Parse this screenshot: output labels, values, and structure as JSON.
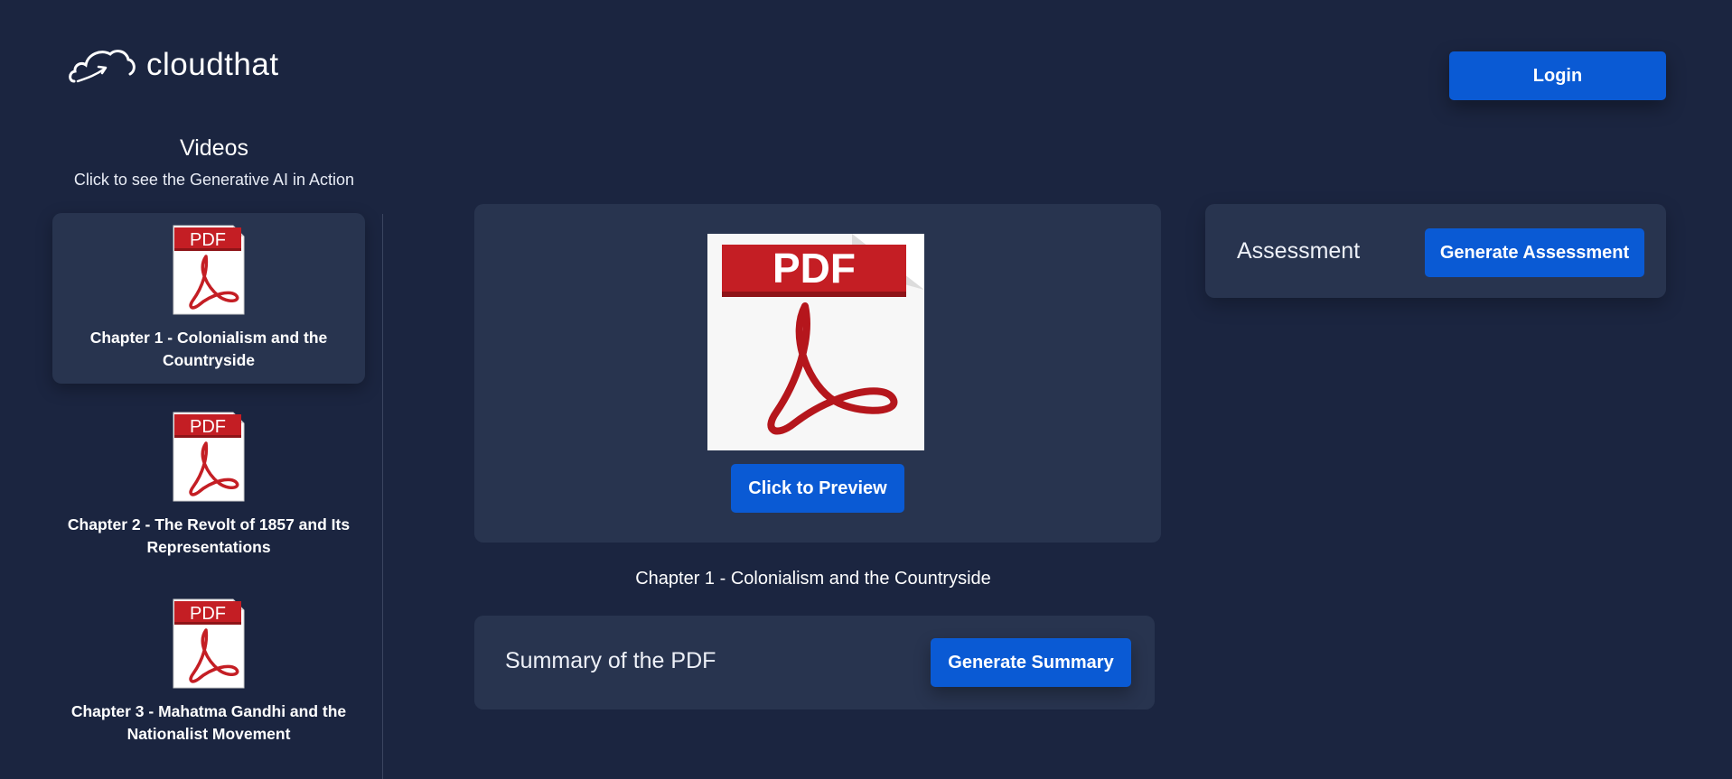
{
  "header": {
    "logo_text": "cloudthat",
    "login_label": "Login"
  },
  "sidebar": {
    "title": "Videos",
    "subtitle": "Click to see the Generative AI in Action",
    "items": [
      {
        "label": "Chapter 1 - Colonialism and the Countryside",
        "icon": "pdf-icon",
        "active": true
      },
      {
        "label": "Chapter 2 - The Revolt of 1857 and Its Representations",
        "icon": "pdf-icon",
        "active": false
      },
      {
        "label": "Chapter 3 - Mahatma Gandhi and the Nationalist Movement",
        "icon": "pdf-icon",
        "active": false
      }
    ]
  },
  "preview": {
    "icon": "pdf-icon",
    "badge_text": "PDF",
    "button_label": "Click to Preview",
    "caption": "Chapter 1 - Colonialism and the Countryside"
  },
  "summary": {
    "label": "Summary of the PDF",
    "button_label": "Generate Summary"
  },
  "assessment": {
    "label": "Assessment",
    "button_label": "Generate Assessment"
  },
  "colors": {
    "background": "#1b2540",
    "panel": "#28344f",
    "accent": "#0a5ad4",
    "pdf_red": "#c41e24"
  }
}
